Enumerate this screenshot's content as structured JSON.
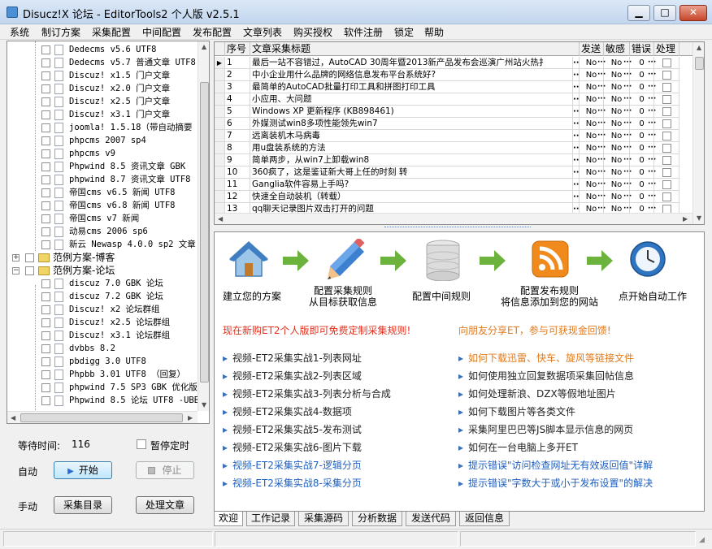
{
  "window": {
    "title": "Disucz!X 论坛  -  EditorTools2 个人版 v2.5.1",
    "min": "▁",
    "max": "□",
    "close": "✕"
  },
  "menu": [
    "系统",
    "制订方案",
    "采集配置",
    "中间配置",
    "发布配置",
    "文章列表",
    "购买授权",
    "软件注册",
    "锁定",
    "帮助"
  ],
  "tree": [
    {
      "label": "Dedecms v5.6 UTF8",
      "type": "doc",
      "level": 2
    },
    {
      "label": "Dedecms v5.7 普通文章 UTF8",
      "type": "doc",
      "level": 2
    },
    {
      "label": "Discuz! x1.5 门户文章",
      "type": "doc",
      "level": 2
    },
    {
      "label": "Discuz! x2.0 门户文章",
      "type": "doc",
      "level": 2
    },
    {
      "label": "Discuz! x2.5 门户文章",
      "type": "doc",
      "level": 2
    },
    {
      "label": "Discuz! x3.1 门户文章",
      "type": "doc",
      "level": 2
    },
    {
      "label": "joomla! 1.5.18（带自动摘要",
      "type": "doc",
      "level": 2
    },
    {
      "label": "phpcms 2007 sp4",
      "type": "doc",
      "level": 2
    },
    {
      "label": "phpcms v9",
      "type": "doc",
      "level": 2
    },
    {
      "label": "Phpwind 8.5 资讯文章 GBK",
      "type": "doc",
      "level": 2
    },
    {
      "label": "phpwind 8.7 资讯文章 UTF8",
      "type": "doc",
      "level": 2
    },
    {
      "label": "帝国cms v6.5 新闻 UTF8",
      "type": "doc",
      "level": 2
    },
    {
      "label": "帝国cms v6.8 新闻 UTF8",
      "type": "doc",
      "level": 2
    },
    {
      "label": "帝国cms v7 新闻",
      "type": "doc",
      "level": 2
    },
    {
      "label": "动易cms 2006 sp6",
      "type": "doc",
      "level": 2
    },
    {
      "label": "新云 Newasp 4.0.0 sp2 文章",
      "type": "doc",
      "level": 2
    },
    {
      "label": "范例方案-博客",
      "type": "folder",
      "level": 1,
      "exp": "+"
    },
    {
      "label": "范例方案-论坛",
      "type": "folder",
      "level": 1,
      "exp": "−"
    },
    {
      "label": "discuz 7.0 GBK 论坛",
      "type": "doc",
      "level": 2
    },
    {
      "label": "discuz 7.2 GBK 论坛",
      "type": "doc",
      "level": 2
    },
    {
      "label": "Discuz! x2 论坛群组",
      "type": "doc",
      "level": 2
    },
    {
      "label": "Discuz! x2.5 论坛群组",
      "type": "doc",
      "level": 2
    },
    {
      "label": "Discuz! x3.1 论坛群组",
      "type": "doc",
      "level": 2
    },
    {
      "label": "dvbbs 8.2",
      "type": "doc",
      "level": 2
    },
    {
      "label": "pbdigg 3.0 UTF8",
      "type": "doc",
      "level": 2
    },
    {
      "label": "Phpbb 3.01 UTF8 （回复）",
      "type": "doc",
      "level": 2
    },
    {
      "label": "phpwind 7.5 SP3 GBK 优化版",
      "type": "doc",
      "level": 2
    },
    {
      "label": "Phpwind 8.5 论坛 UTF8 -UBB",
      "type": "doc",
      "level": 2
    }
  ],
  "left_controls": {
    "wait_label": "等待时间:",
    "wait_value": "116",
    "pause_label": "暂停定时",
    "auto_label": "自动",
    "start": "开始",
    "stop": "停止",
    "manual_label": "手动",
    "collect_dir": "采集目录",
    "process": "处理文章"
  },
  "grid": {
    "headers": [
      "序号",
      "文章采集标题",
      "发送",
      "敏感",
      "错误",
      "处理"
    ],
    "rows": [
      {
        "n": "1",
        "title": "最后一站不容错过，AutoCAD 30周年暨2013新产品发布会巡演广州站火热扌",
        "send": "No",
        "sens": "No",
        "err": "0"
      },
      {
        "n": "2",
        "title": "中小企业用什么品牌的网络信息发布平台系统好?",
        "send": "No",
        "sens": "No",
        "err": "0"
      },
      {
        "n": "3",
        "title": "最简单的AutoCAD批量打印工具和拼图打印工具",
        "send": "No",
        "sens": "No",
        "err": "0"
      },
      {
        "n": "4",
        "title": "小应用、大问题",
        "send": "No",
        "sens": "No",
        "err": "0"
      },
      {
        "n": "5",
        "title": "Windows XP 更新程序 (KB898461)",
        "send": "No",
        "sens": "No",
        "err": "0"
      },
      {
        "n": "6",
        "title": "外媒测试win8多项性能领先win7",
        "send": "No",
        "sens": "No",
        "err": "0"
      },
      {
        "n": "7",
        "title": "远离装机木马病毒",
        "send": "No",
        "sens": "No",
        "err": "0"
      },
      {
        "n": "8",
        "title": "用u盘装系统的方法",
        "send": "No",
        "sens": "No",
        "err": "0"
      },
      {
        "n": "9",
        "title": "简单两步，从win7上卸载win8",
        "send": "No",
        "sens": "No",
        "err": "0"
      },
      {
        "n": "10",
        "title": "360疯了，这是鉴证新大哥上任的时刻 转",
        "send": "No",
        "sens": "No",
        "err": "0"
      },
      {
        "n": "11",
        "title": "Ganglia软件容易上手吗?",
        "send": "No",
        "sens": "No",
        "err": "0"
      },
      {
        "n": "12",
        "title": "快速全自动装机（转载）",
        "send": "No",
        "sens": "No",
        "err": "0"
      },
      {
        "n": "13",
        "title": "qq聊天记录图片双击打开的问题",
        "send": "No",
        "sens": "No",
        "err": "0"
      }
    ],
    "dots": "···"
  },
  "steps": [
    {
      "line1": "建立您的方案",
      "line2": ""
    },
    {
      "line1": "配置采集规则",
      "line2": "从目标获取信息"
    },
    {
      "line1": "配置中间规则",
      "line2": ""
    },
    {
      "line1": "配置发布规则",
      "line2": "将信息添加到您的网站"
    },
    {
      "line1": "点开始自动工作",
      "line2": ""
    }
  ],
  "promo": {
    "left": "现在新购ET2个人版即可免费定制采集规则!",
    "right": "向朋友分享ET，参与可获现金回馈!",
    "bullet": "▸"
  },
  "links_left": [
    "视频-ET2采集实战1-列表网址",
    "视频-ET2采集实战2-列表区域",
    "视频-ET2采集实战3-列表分析与合成",
    "视频-ET2采集实战4-数据项",
    "视频-ET2采集实战5-发布测试",
    "视频-ET2采集实战6-图片下载",
    "视频-ET2采集实战7-逻辑分页",
    "视频-ET2采集实战8-采集分页"
  ],
  "links_right": [
    "如何下载迅雷、快车、旋风等链接文件",
    "如何使用独立回复数据项采集回帖信息",
    "如何处理新浪、DZX等假地址图片",
    "如何下载图片等各类文件",
    "采集阿里巴巴等JS脚本显示信息的网页",
    "如何在一台电脑上多开ET",
    "提示错误\"访问检查网址无有效返回值\"详解",
    "提示错误\"字数大于或小于发布设置\"的解决"
  ],
  "tabs": [
    "欢迎",
    "工作记录",
    "采集源码",
    "分析数据",
    "发送代码",
    "返回信息"
  ],
  "colors": {
    "promo_red": "#e0301e",
    "promo_orange": "#e07a1e",
    "link_dark": "#222222",
    "link_blue": "#1f5fbf",
    "link_orange": "#e07a1e"
  }
}
